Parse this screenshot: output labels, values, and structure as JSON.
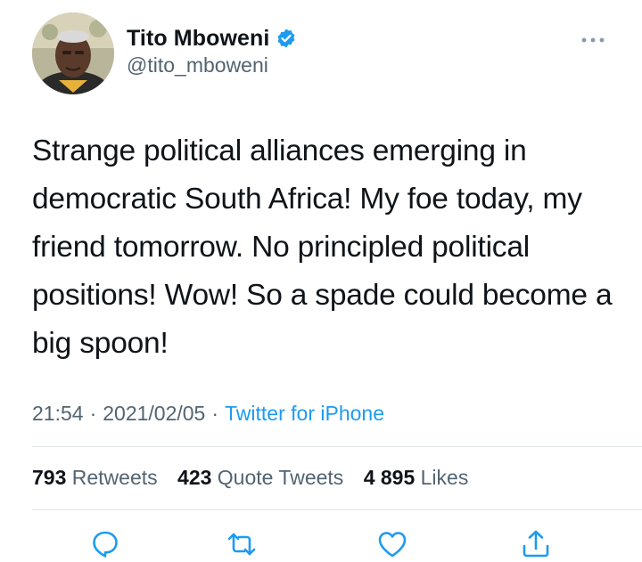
{
  "author": {
    "display_name": "Tito Mboweni",
    "handle": "@tito_mboweni",
    "verified": true,
    "avatar_icon": "avatar-photo",
    "verified_icon": "verified-badge-icon"
  },
  "tweet": {
    "text": "Strange political alliances emerging in democratic South Africa! My foe today, my friend tomorrow. No principled political positions! Wow! So a spade could become a big spoon!",
    "time": "21:54",
    "date": "2021/02/05",
    "separator": "·",
    "source": "Twitter for iPhone"
  },
  "stats": {
    "retweets_count": "793",
    "retweets_label": "Retweets",
    "quotes_count": "423",
    "quotes_label": "Quote Tweets",
    "likes_count": "4 895",
    "likes_label": "Likes"
  },
  "actions": {
    "reply_icon": "reply-icon",
    "retweet_icon": "retweet-icon",
    "like_icon": "like-icon",
    "share_icon": "share-icon",
    "more_icon": "more-icon"
  },
  "colors": {
    "text": "#0f1419",
    "secondary": "#536471",
    "accent": "#1d9bf0",
    "divider": "#e1e4e6"
  }
}
